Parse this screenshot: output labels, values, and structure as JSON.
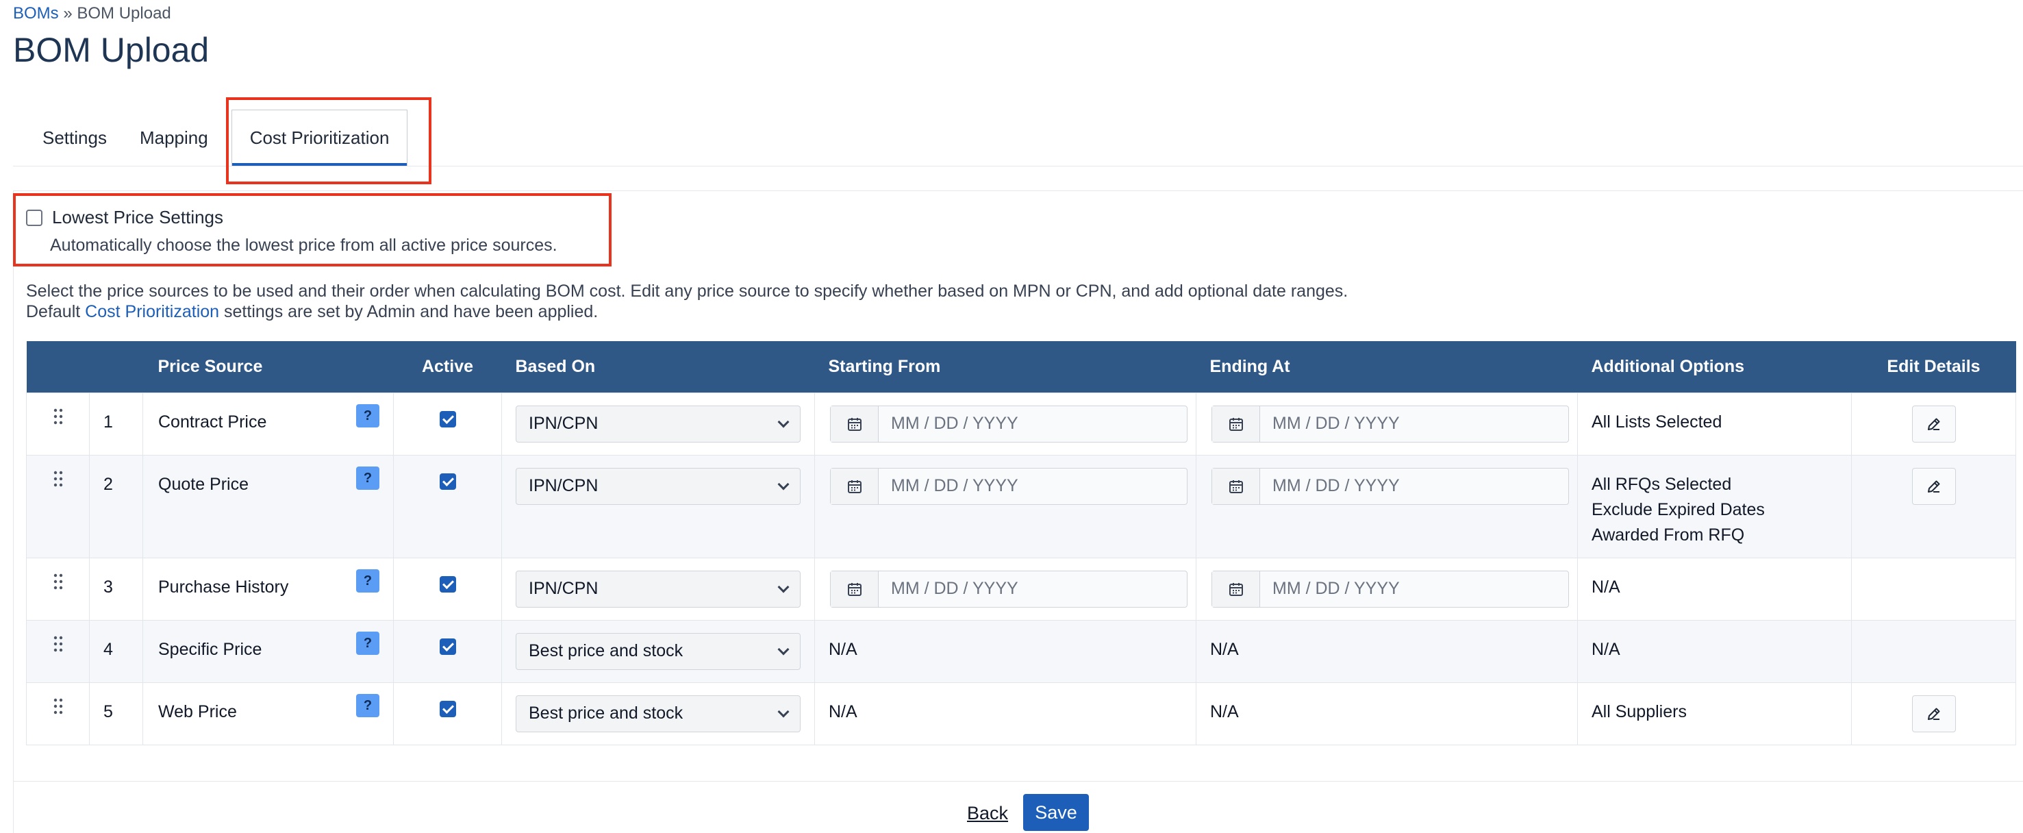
{
  "breadcrumb": {
    "parent": "BOMs",
    "separator": "»",
    "current": "BOM Upload"
  },
  "page": {
    "title": "BOM Upload"
  },
  "tabs": [
    {
      "label": "Settings"
    },
    {
      "label": "Mapping"
    },
    {
      "label": "Cost Prioritization"
    }
  ],
  "lowest_price": {
    "label": "Lowest Price Settings",
    "description": "Automatically choose the lowest price from all active price sources.",
    "checked": false
  },
  "intro": {
    "line1": "Select the price sources to be used and their order when calculating BOM cost. Edit any price source to specify whether based on MPN or CPN, and add optional date ranges.",
    "line2_prefix": "Default",
    "line2_link": "Cost Prioritization",
    "line2_suffix": "settings are set by Admin and have been applied."
  },
  "table": {
    "columns": [
      "",
      "",
      "Price Source",
      "Active",
      "Based On",
      "Starting From",
      "Ending At",
      "Additional Options",
      "Edit Details"
    ],
    "date_placeholder": "MM / DD / YYYY",
    "rows": [
      {
        "num": "1",
        "source": "Contract Price",
        "help": "?",
        "active": true,
        "based_on": "IPN/CPN",
        "start": "",
        "end": "",
        "options": [
          "All Lists Selected"
        ],
        "editable": true
      },
      {
        "num": "2",
        "source": "Quote Price",
        "help": "?",
        "active": true,
        "based_on": "IPN/CPN",
        "start": "",
        "end": "",
        "options": [
          "All RFQs Selected",
          "Exclude Expired Dates",
          "Awarded From RFQ"
        ],
        "editable": true
      },
      {
        "num": "3",
        "source": "Purchase History",
        "help": "?",
        "active": true,
        "based_on": "IPN/CPN",
        "start": "",
        "end": "",
        "options": [
          "N/A"
        ],
        "editable": false
      },
      {
        "num": "4",
        "source": "Specific Price",
        "help": "?",
        "active": true,
        "based_on": "Best price and stock",
        "start": "N/A",
        "end": "N/A",
        "options": [
          "N/A"
        ],
        "editable": false
      },
      {
        "num": "5",
        "source": "Web Price",
        "help": "?",
        "active": true,
        "based_on": "Best price and stock",
        "start": "N/A",
        "end": "N/A",
        "options": [
          "All Suppliers"
        ],
        "editable": true
      }
    ]
  },
  "actions": {
    "back_label": "Back",
    "save_label": "Save"
  },
  "colors": {
    "header_bg": "#2f5887",
    "accent": "#1d5fb8",
    "highlight": "#e8331f",
    "help_bg": "#5b9cf5"
  }
}
